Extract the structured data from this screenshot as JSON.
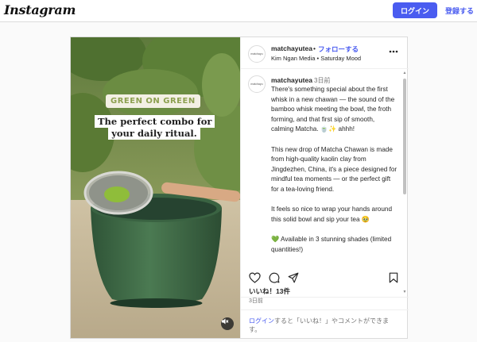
{
  "topbar": {
    "logo": "Instagram",
    "login_label": "ログイン",
    "signup_label": "登録する"
  },
  "post": {
    "media": {
      "overlay_tag": "GREEN ON GREEN",
      "overlay_headline": "The perfect combo for your daily ritual.",
      "mute_icon": "speaker-muted-icon"
    },
    "header": {
      "avatar_text": "matchayu",
      "username": "matchayutea",
      "separator": "•",
      "follow_label": "フォローする",
      "subline": "Kim Ngan Media • Saturday Mood"
    },
    "caption": {
      "avatar_text": "matchayu",
      "username": "matchayutea",
      "time": "3日前",
      "paragraphs": [
        "There's something special about the first whisk in a new chawan — the sound of the bamboo whisk meeting the bowl, the froth forming, and that first sip of smooth, calming Matcha. 🍵✨ ahhh!",
        "This new drop of Matcha Chawan is made from high-quality kaolin clay from Jingdezhen, China, it's a piece designed for mindful tea moments — or the perfect gift for a tea-loving friend.",
        "It feels so nice to wrap your hands around this solid bowl and sip your tea 🥹",
        "💚 Available in 3 stunning shades (limited quantities!)"
      ]
    },
    "actions": {
      "icons": [
        "heart-icon",
        "comment-icon",
        "share-icon",
        "bookmark-icon"
      ]
    },
    "likes": "いいね！13件",
    "date": "3日前",
    "login_prompt": {
      "link": "ログイン",
      "text": "すると「いいね！」やコメントができます。"
    }
  },
  "colors": {
    "accent": "#4a5cf0",
    "border": "#dbdbdb",
    "bowl_green": "#3f6a45"
  }
}
